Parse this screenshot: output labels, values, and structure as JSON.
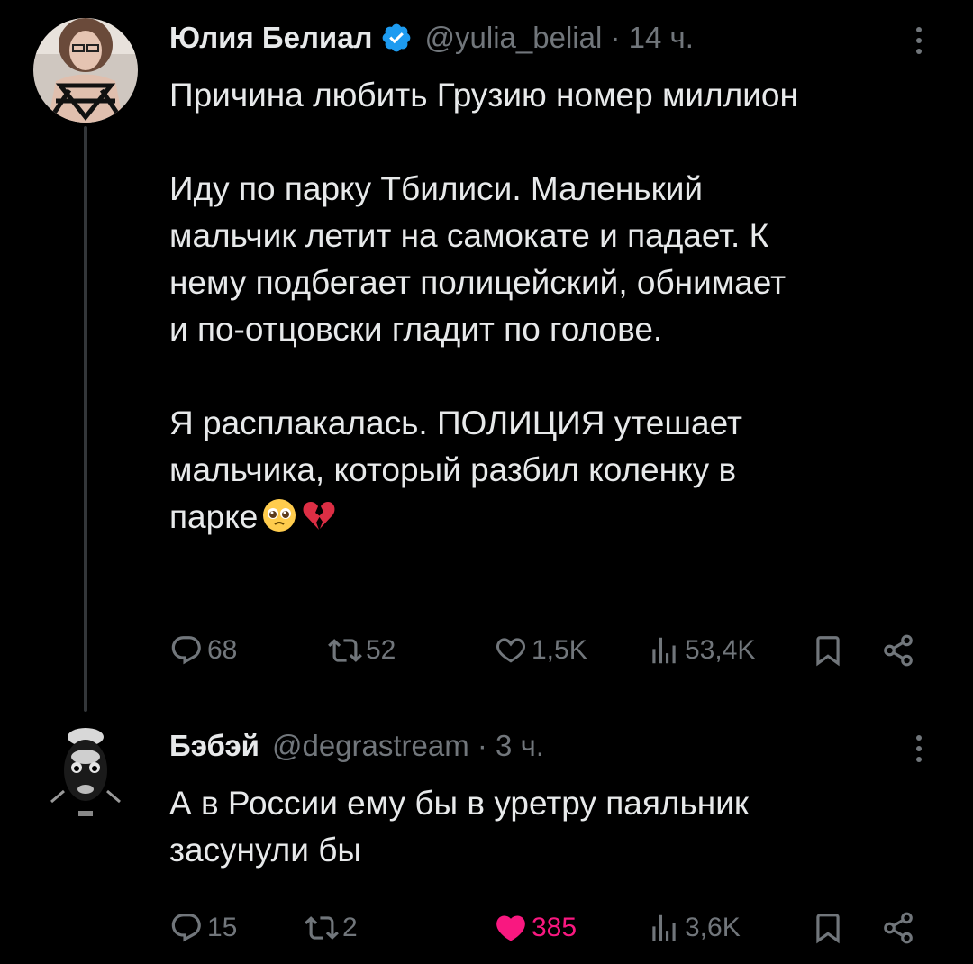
{
  "tweets": [
    {
      "author_name": "Юлия Белиал",
      "handle_time": "@yulia_belial · 14 ч.",
      "paragraphs": [
        [
          "Причина любить Грузию номер миллион"
        ],
        [
          "Иду по парку Тбилиси. Маленький",
          "мальчик летит на самокате и падает. К",
          "нему подбегает полицейский, обнимает",
          "и по-отцовски гладит по голове."
        ],
        [
          "Я расплакалась. ПОЛИЦИЯ утешает",
          "мальчика, который разбил коленку в",
          "парке"
        ]
      ],
      "emojis": [
        "pleading-face-emoji",
        "broken-heart-emoji"
      ],
      "replies": "68",
      "retweets": "52",
      "likes": "1,5K",
      "views": "53,4K",
      "liked": false
    },
    {
      "author_name": "Бэбэй",
      "handle_time": "@degrastream · 3 ч.",
      "lines": [
        "А в России ему бы в уретру паяльник",
        "засунули бы"
      ],
      "replies": "15",
      "retweets": "2",
      "likes": "385",
      "views": "3,6K",
      "liked": true
    }
  ],
  "colors": {
    "background": "#000000",
    "text": "#e7e9ea",
    "secondary": "#71767b",
    "verified": "#1d9bf0",
    "like": "#f91880"
  },
  "icons": [
    "reply-icon",
    "retweet-icon",
    "like-icon",
    "views-icon",
    "bookmark-icon",
    "share-icon",
    "more-icon",
    "verified-badge-icon"
  ]
}
